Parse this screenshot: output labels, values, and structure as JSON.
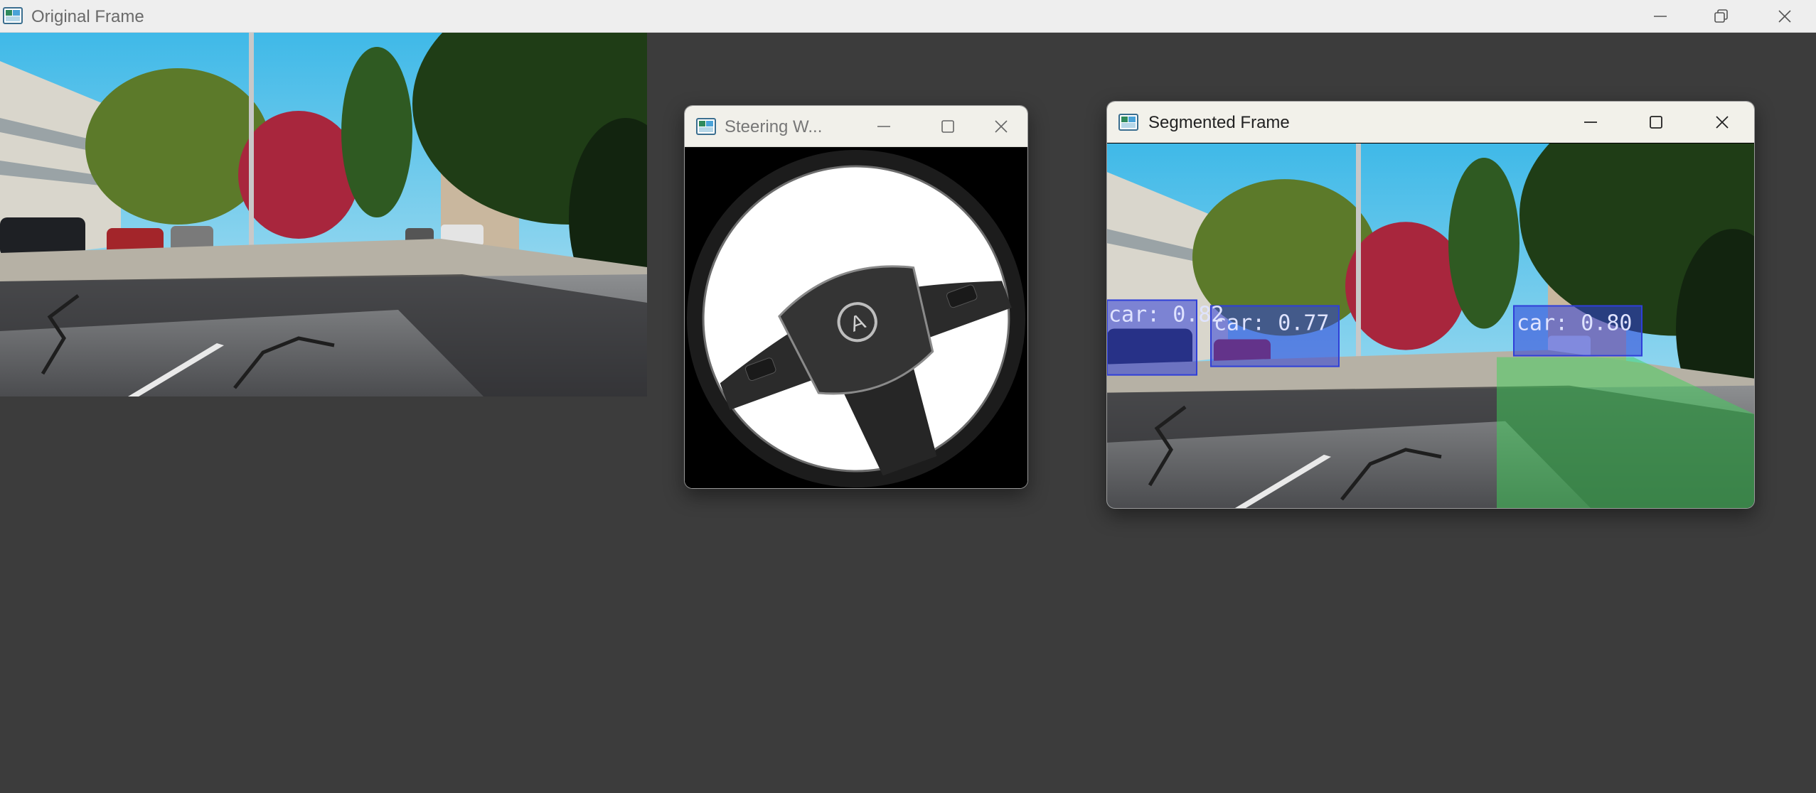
{
  "main_window": {
    "title": "Original Frame",
    "icon": "opencv-window-icon",
    "controls": [
      "minimize-icon",
      "restore-icon",
      "close-icon"
    ]
  },
  "steering_window": {
    "title": "Steering W...",
    "icon": "opencv-window-icon",
    "controls": [
      "minimize-icon",
      "maximize-icon",
      "close-icon"
    ],
    "content": "steering-wheel-image",
    "logo_text": "A"
  },
  "segmented_window": {
    "title": "Segmented Frame",
    "icon": "opencv-window-icon",
    "controls": [
      "minimize-icon",
      "maximize-icon",
      "close-icon"
    ],
    "detections": [
      {
        "label": "car: 0.82"
      },
      {
        "label": "car: 0.77"
      },
      {
        "label": "car: 0.80"
      }
    ],
    "colors": {
      "detection_box": "#2f3fd8",
      "lane_overlay": "#3fd15a"
    }
  },
  "colors": {
    "desktop_bg": "#3c3c3c",
    "main_titlebar": "#eeeeee",
    "child_titlebar": "#f1f0ea"
  }
}
